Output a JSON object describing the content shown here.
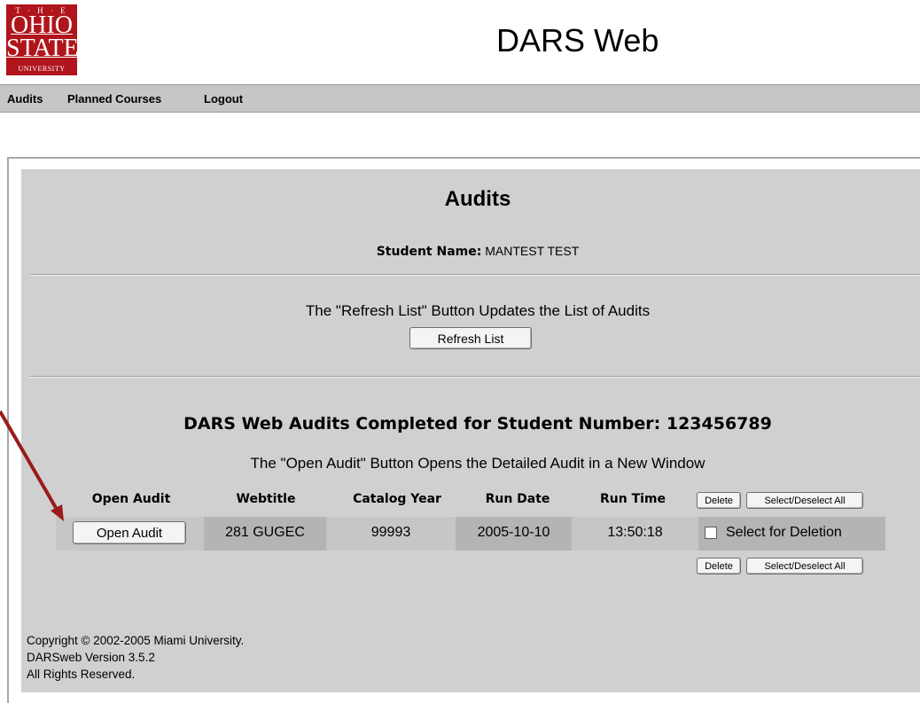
{
  "logo": {
    "line_the": "T · H · E",
    "line1": "OHIO",
    "line2": "STATE",
    "line3": "UNIVERSITY"
  },
  "app_title": "DARS Web",
  "nav": [
    "Audits",
    "Planned Courses",
    "Logout"
  ],
  "page": {
    "heading": "Audits",
    "student_label": "Student Name:",
    "student_name": "MANTEST TEST",
    "refresh_text": "The \"Refresh List\" Button Updates the List of Audits",
    "refresh_button": "Refresh List",
    "completed_heading": "DARS Web Audits Completed for Student Number: 123456789",
    "open_text": "The \"Open Audit\" Button Opens the Detailed Audit in a New Window"
  },
  "table": {
    "headers": [
      "Open Audit",
      "Webtitle",
      "Catalog Year",
      "Run Date",
      "Run Time"
    ],
    "delete_button": "Delete",
    "select_all_button": "Select/Deselect All",
    "row": {
      "open_button": "Open Audit",
      "webtitle": "281 GUGEC",
      "catalog_year": "99993",
      "run_date": "2005-10-10",
      "run_time": "13:50:18",
      "checkbox_label": "Select for Deletion",
      "checked": false
    }
  },
  "footer": {
    "line1": "Copyright © 2002-2005 Miami University.",
    "line2": "DARSweb Version 3.5.2",
    "line3": "All Rights Reserved."
  },
  "colors": {
    "logo_red": "#b0151c",
    "navbar_gray": "#c6c6c6",
    "panel_gray": "#d0d0d0",
    "row_gray": "#b4b4b4",
    "arrow_red": "#9b1b1b"
  }
}
